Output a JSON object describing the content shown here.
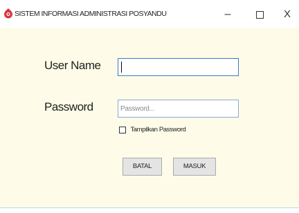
{
  "window": {
    "title": "SISTEM INFORMASI ADMINISTRASI POSYANDU",
    "icon": "app-logo-icon",
    "controls": {
      "minimize": "–",
      "close": "X"
    }
  },
  "form": {
    "username_label": "User Name",
    "username_value": "",
    "password_label": "Password",
    "password_value": "",
    "password_placeholder": "Password...",
    "show_password_label": "Tampilkan Password",
    "show_password_checked": false
  },
  "buttons": {
    "cancel": "BATAL",
    "submit": "MASUK"
  },
  "colors": {
    "background": "#fefce8",
    "titlebar": "#ffffff",
    "focus_border": "#3a79c8",
    "logo": "#d9363e"
  }
}
